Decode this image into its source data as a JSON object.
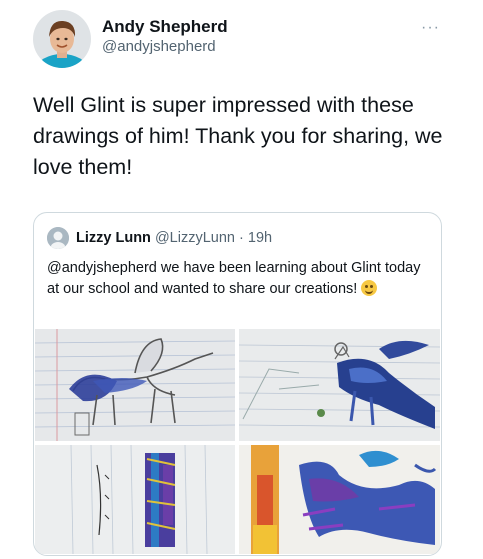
{
  "tweet": {
    "author_name": "Andy Shepherd",
    "author_handle": "@andyjshepherd",
    "more_icon": "more-horizontal-icon",
    "text": "Well Glint is super impressed with these drawings of him! Thank you for sharing, we love them!"
  },
  "quote": {
    "name": "Lizzy Lunn",
    "handle": "@LizzyLunn",
    "separator": "·",
    "time": "19h",
    "text": "@andyjshepherd we have been learning about Glint today at our school and wanted to share our creations!",
    "emoji": "smiling-face-icon"
  },
  "colors": {
    "handle_gray": "#536471",
    "border": "#cfd9de",
    "paper": "#eef0f2",
    "ink_blue": "#2b3f9e"
  }
}
